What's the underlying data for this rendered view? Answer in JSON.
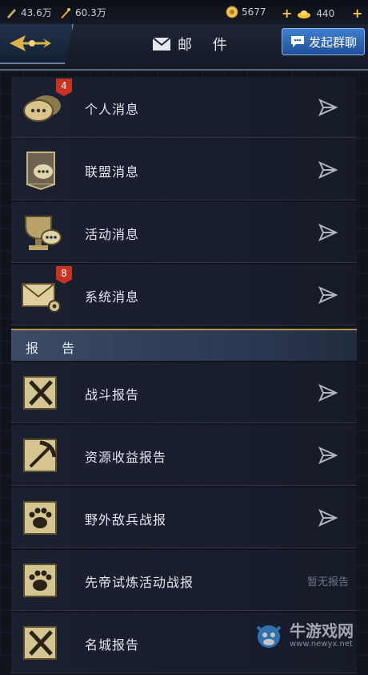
{
  "status": {
    "res1": "43.6万",
    "res2": "60.3万",
    "coins": "5677",
    "gold": "440"
  },
  "header": {
    "title_icon": "envelope-icon",
    "title": "邮  件",
    "group_chat": "发起群聊"
  },
  "messages": [
    {
      "label": "个人消息",
      "icon": "chat-bubbles-icon",
      "badge": "4"
    },
    {
      "label": "联盟消息",
      "icon": "alliance-banner-icon",
      "badge": ""
    },
    {
      "label": "活动消息",
      "icon": "trophy-chat-icon",
      "badge": ""
    },
    {
      "label": "系统消息",
      "icon": "mail-gear-icon",
      "badge": "8"
    }
  ],
  "section": {
    "label": "报 告"
  },
  "reports": [
    {
      "label": "战斗报告",
      "icon": "crossed-swords-scroll-icon",
      "status": ""
    },
    {
      "label": "资源收益报告",
      "icon": "pickaxe-scroll-icon",
      "status": ""
    },
    {
      "label": "野外敌兵战报",
      "icon": "paw-scroll-icon",
      "status": ""
    },
    {
      "label": "先帝试炼活动战报",
      "icon": "paw-scroll-icon",
      "status": "暂无报告"
    },
    {
      "label": "名城报告",
      "icon": "crossed-swords-scroll-icon",
      "status": ""
    }
  ],
  "watermark": {
    "text": "牛游戏网",
    "url": "www.newyx.net"
  },
  "colors": {
    "accent_gold": "#d9b24a",
    "badge_red": "#c8321f",
    "button_blue": "#2f6cc0"
  }
}
